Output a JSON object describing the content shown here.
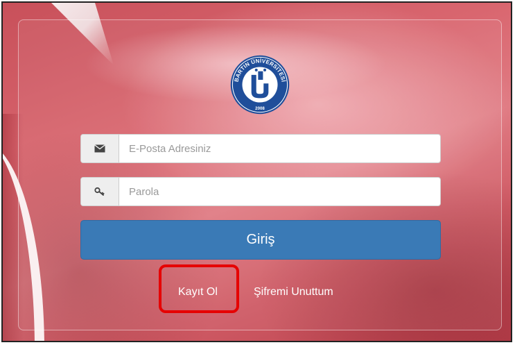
{
  "logo": {
    "arc_text": "BARTIN ÜNİVERSİTESİ",
    "year": "2008",
    "monogram": "ÜB"
  },
  "form": {
    "email_placeholder": "E-Posta Adresiniz",
    "email_icon": "envelope-icon",
    "password_placeholder": "Parola",
    "password_icon": "key-icon",
    "submit_label": "Giriş"
  },
  "links": {
    "register": "Kayıt Ol",
    "forgot_password": "Şifremi Unuttum"
  },
  "colors": {
    "button": "#3a7ab6",
    "highlight": "#e60000",
    "background": "#d9666f",
    "logo_blue": "#1f4e9a"
  }
}
